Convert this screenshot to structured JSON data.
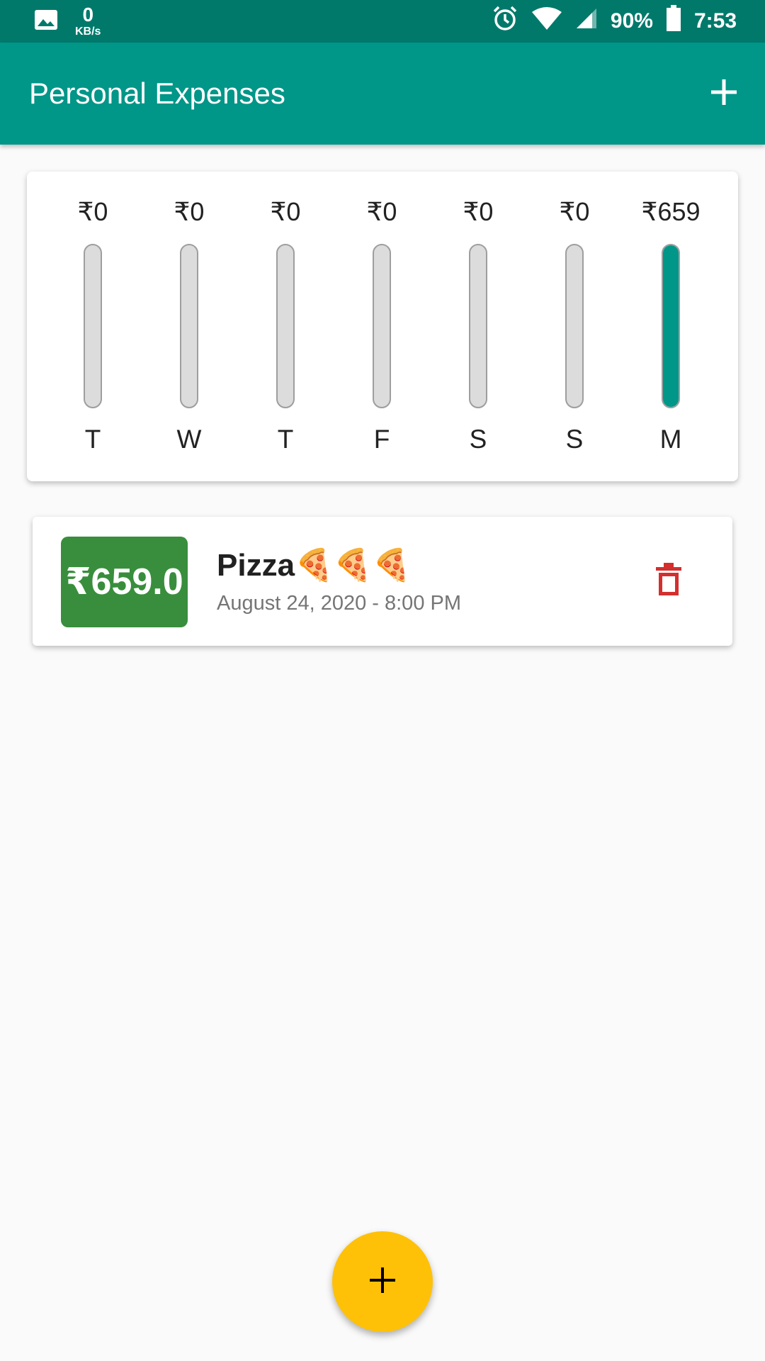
{
  "status_bar": {
    "net_speed": "0",
    "net_unit": "KB/s",
    "battery": "90%",
    "time": "7:53"
  },
  "app_bar": {
    "title": "Personal Expenses",
    "add_icon": "plus-icon"
  },
  "chart_data": {
    "type": "bar",
    "categories": [
      "T",
      "W",
      "T",
      "F",
      "S",
      "S",
      "M"
    ],
    "amount_labels": [
      "₹0",
      "₹0",
      "₹0",
      "₹0",
      "₹0",
      "₹0",
      "₹659"
    ],
    "values": [
      0,
      0,
      0,
      0,
      0,
      0,
      659
    ],
    "colors": {
      "fill": "#009688",
      "track": "#dcdcdc"
    }
  },
  "transactions": [
    {
      "amount": "₹659.0",
      "title": "Pizza🍕🍕🍕",
      "date": "August 24, 2020 - 8:00 PM",
      "delete_icon": "trash-icon"
    }
  ],
  "fab": {
    "icon": "plus-icon"
  },
  "colors": {
    "status_bar": "#00796b",
    "primary": "#009688",
    "accent": "#ffc107",
    "amount_badge": "#388e3c",
    "delete": "#d32f2f"
  }
}
